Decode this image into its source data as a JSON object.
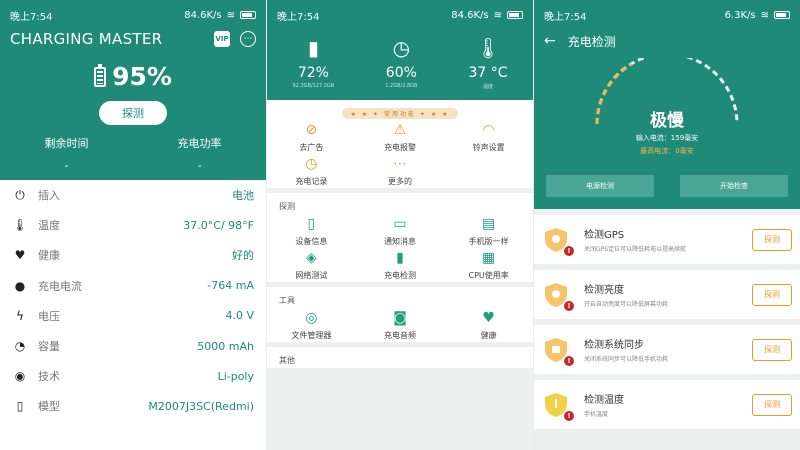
{
  "panel1": {
    "status": {
      "time": "晚上7:54",
      "net": "84.6K/s"
    },
    "app_title": "CHARGING MASTER",
    "vip_label": "VIP",
    "battery_percent": "95%",
    "detect_button": "探测",
    "remaining_label": "剩余时间",
    "remaining_value": "-",
    "power_label": "充电功率",
    "power_value": "-",
    "info": [
      {
        "icon": "plug-icon",
        "label": "插入",
        "value": "电池"
      },
      {
        "icon": "thermometer-icon",
        "label": "温度",
        "value": "37.0°C/ 98°F"
      },
      {
        "icon": "heart-icon",
        "label": "健康",
        "value": "好的"
      },
      {
        "icon": "bulb-icon",
        "label": "充电电流",
        "value": "-764 mA"
      },
      {
        "icon": "bolt-icon",
        "label": "电压",
        "value": "4.0 V"
      },
      {
        "icon": "gauge-icon",
        "label": "容量",
        "value": "5000 mAh"
      },
      {
        "icon": "tech-icon",
        "label": "技术",
        "value": "Li-poly"
      },
      {
        "icon": "phone-icon",
        "label": "模型",
        "value": "M2007J3SC(Redmi)"
      }
    ]
  },
  "panel2": {
    "status": {
      "time": "晚上7:54",
      "net": "84.6K/s"
    },
    "stats": [
      {
        "icon": "sd-card-icon",
        "value": "72%",
        "sub": "92.3GB/127.2GB"
      },
      {
        "icon": "speedometer-icon",
        "value": "60%",
        "sub": "1.2GB/2.8GB"
      },
      {
        "icon": "thermometer-icon",
        "value": "37 °C",
        "sub": "温度"
      }
    ],
    "banner": "★ ★ ✦ 常用功能 ✦ ★ ★",
    "top_grid": [
      {
        "icon": "no-ads-icon",
        "label": "去广告"
      },
      {
        "icon": "alarm-icon",
        "label": "充电报警"
      },
      {
        "icon": "headset-icon",
        "label": "铃声设置"
      },
      {
        "icon": "clock-icon",
        "label": "充电记录"
      },
      {
        "icon": "more-icon",
        "label": "更多的"
      }
    ],
    "section_detect": "探测",
    "detect_grid": [
      {
        "icon": "phone-icon",
        "label": "设备信息"
      },
      {
        "icon": "chat-icon",
        "label": "通知消息"
      },
      {
        "icon": "clipboard-icon",
        "label": "手机版一样"
      },
      {
        "icon": "signal-icon",
        "label": "网络测试"
      },
      {
        "icon": "battery-icon",
        "label": "充电检测"
      },
      {
        "icon": "cpu-icon",
        "label": "CPU使用率"
      }
    ],
    "section_tools": "工具",
    "tools_grid": [
      {
        "icon": "file-icon",
        "label": "文件管理器"
      },
      {
        "icon": "android-icon",
        "label": "充电音频"
      },
      {
        "icon": "heart-icon",
        "label": "健康"
      }
    ],
    "section_other": "其他"
  },
  "panel3": {
    "status": {
      "time": "晚上7:54",
      "net": "6.3K/s"
    },
    "title": "充电检测",
    "speed": "极慢",
    "input_current": "输入电流：159毫安",
    "max_current": "最高电流：0毫安",
    "btn_left": "电源检测",
    "btn_right": "开始检查",
    "checks": [
      {
        "title": "检测GPS",
        "desc": "关闭GPS定位可以降低耗电以提高续航",
        "button": "探测"
      },
      {
        "title": "检测亮度",
        "desc": "开启自动亮度可以降低屏幕功耗",
        "button": "探测"
      },
      {
        "title": "检测系统同步",
        "desc": "关闭系统同步可以降低手机功耗",
        "button": "探测"
      },
      {
        "title": "检测温度",
        "desc": "手机温度",
        "button": "探测"
      }
    ],
    "colors": {
      "teal": "#1f8a78",
      "orange": "#e89b2a",
      "alert": "#c62828"
    }
  }
}
